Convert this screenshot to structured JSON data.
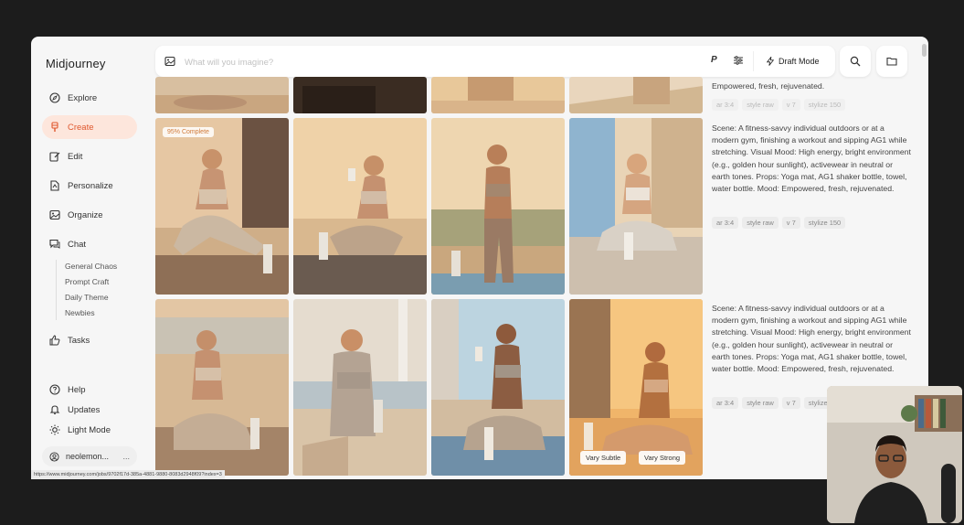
{
  "app": {
    "title": "Midjourney"
  },
  "sidebar": {
    "items": [
      {
        "label": "Explore",
        "icon": "compass-icon"
      },
      {
        "label": "Create",
        "icon": "brush-icon",
        "active": true
      },
      {
        "label": "Edit",
        "icon": "edit-icon"
      },
      {
        "label": "Personalize",
        "icon": "personalize-icon"
      },
      {
        "label": "Organize",
        "icon": "image-icon"
      },
      {
        "label": "Chat",
        "icon": "chat-icon"
      },
      {
        "label": "Tasks",
        "icon": "thumbs-up-icon"
      }
    ],
    "chat_rooms": [
      "General Chaos",
      "Prompt Craft",
      "Daily Theme",
      "Newbies"
    ],
    "bottom_items": [
      {
        "label": "Help",
        "icon": "help-icon"
      },
      {
        "label": "Updates",
        "icon": "bell-icon"
      },
      {
        "label": "Light Mode",
        "icon": "sun-icon"
      }
    ],
    "user": {
      "name": "neolemon...",
      "menu": "..."
    }
  },
  "search": {
    "placeholder": "What will you imagine?",
    "value": "",
    "p_label": "P",
    "draft_mode_label": "Draft Mode"
  },
  "jobs": {
    "top_partial": {
      "prompt_tail": "Empowered, fresh, rejuvenated.",
      "tags": [
        "ar 3:4",
        "style raw",
        "v 7",
        "stylize 150"
      ]
    },
    "rows": [
      {
        "progress_badge": "95% Complete",
        "prompt": "Scene: A fitness-savvy individual outdoors or at a modern gym, finishing a workout and sipping AG1 while stretching. Visual Mood: High energy, bright environment (e.g., golden hour sunlight), activewear in neutral or earth tones. Props: Yoga mat, AG1 shaker bottle, towel, water bottle. Mood: Empowered, fresh, rejuvenated.",
        "tags": [
          "ar 3:4",
          "style raw",
          "v 7",
          "stylize 150"
        ]
      },
      {
        "prompt": "Scene: A fitness-savvy individual outdoors or at a modern gym, finishing a workout and sipping AG1 while stretching. Visual Mood: High energy, bright environment (e.g., golden hour sunlight), activewear in neutral or earth tones. Props: Yoga mat, AG1 shaker bottle, towel, water bottle. Mood: Empowered, fresh, rejuvenated.",
        "tags": [
          "ar 3:4",
          "style raw",
          "v 7",
          "stylize 150"
        ],
        "vary_subtle_label": "Vary Subtle",
        "vary_strong_label": "Vary Strong"
      }
    ]
  },
  "status_url": "https://www.midjourney.com/jobs/9702f17d-385a-4881-9880-8083d2948f09?index=3",
  "colors": {
    "accent": "#e0582e",
    "active_bg": "#fde6dc",
    "window_bg": "#f6f6f6",
    "backdrop": "#1c1c1c"
  }
}
